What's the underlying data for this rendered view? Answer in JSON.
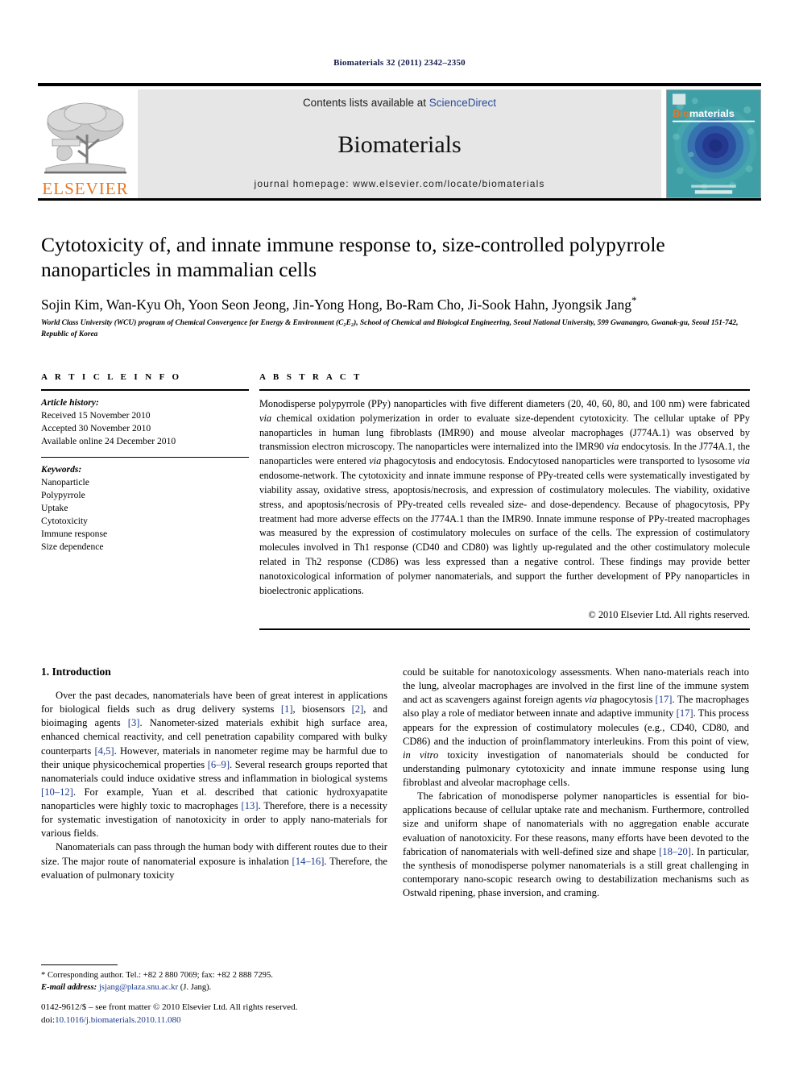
{
  "running_head": "Biomaterials 32 (2011) 2342–2350",
  "masthead": {
    "publisher_name": "ELSEVIER",
    "contents_prefix": "Contents lists available at ",
    "contents_link": "ScienceDirect",
    "journal_name": "Biomaterials",
    "homepage": "journal homepage: www.elsevier.com/locate/biomaterials",
    "cover_title_accent": "Bio",
    "cover_title_rest": "materials",
    "accent_color": "#E87722",
    "link_color": "#2a4b9b",
    "band_color": "#e6e6e6",
    "cover_color": "#2f8f96"
  },
  "article": {
    "title": "Cytotoxicity of, and innate immune response to, size-controlled polypyrrole nanoparticles in mammalian cells",
    "authors": "Sojin Kim, Wan-Kyu Oh, Yoon Seon Jeong, Jin-Yong Hong, Bo-Ram Cho, Ji-Sook Hahn, Jyongsik Jang",
    "corresponding_marker": "*",
    "affiliation": "World Class University (WCU) program of Chemical Convergence for Energy & Environment (C₂E₂), School of Chemical and Biological Engineering, Seoul National University, 599 Gwanangro, Gwanak-gu, Seoul 151-742, Republic of Korea"
  },
  "article_info": {
    "heading": "A R T I C L E   I N F O",
    "history_label": "Article history:",
    "history": [
      "Received 15 November 2010",
      "Accepted 30 November 2010",
      "Available online 24 December 2010"
    ],
    "keywords_label": "Keywords:",
    "keywords": [
      "Nanoparticle",
      "Polypyrrole",
      "Uptake",
      "Cytotoxicity",
      "Immune response",
      "Size dependence"
    ]
  },
  "abstract": {
    "heading": "A B S T R A C T",
    "paragraphs": [
      "Monodisperse polypyrrole (PPy) nanoparticles with five different diameters (20, 40, 60, 80, and 100 nm) were fabricated <i>via</i> chemical oxidation polymerization in order to evaluate size-dependent cytotoxicity. The cellular uptake of PPy nanoparticles in human lung fibroblasts (IMR90) and mouse alveolar macrophages (J774A.1) was observed by transmission electron microscopy. The nanoparticles were internalized into the IMR90 <i>via</i> endocytosis. In the J774A.1, the nanoparticles were entered <i>via</i> phagocytosis and endocytosis. Endocytosed nanoparticles were transported to lysosome <i>via</i> endosome-network. The cytotoxicity and innate immune response of PPy-treated cells were systematically investigated by viability assay, oxidative stress, apoptosis/necrosis, and expression of costimulatory molecules. The viability, oxidative stress, and apoptosis/necrosis of PPy-treated cells revealed size- and dose-dependency. Because of phagocytosis, PPy treatment had more adverse effects on the J774A.1 than the IMR90. Innate immune response of PPy-treated macrophages was measured by the expression of costimulatory molecules on surface of the cells. The expression of costimulatory molecules involved in Th1 response (CD40 and CD80) was lightly up-regulated and the other costimulatory molecule related in Th2 response (CD86) was less expressed than a negative control. These findings may provide better nanotoxicological information of polymer nanomaterials, and support the further development of PPy nanoparticles in bioelectronic applications."
    ],
    "copyright": "© 2010 Elsevier Ltd. All rights reserved."
  },
  "section": {
    "number_title": "1.  Introduction",
    "left_paragraphs": [
      "Over the past decades, nanomaterials have been of great interest in applications for biological fields such as drug delivery systems <span class=\"ref\">[1]</span>, biosensors <span class=\"ref\">[2]</span>, and bioimaging agents <span class=\"ref\">[3]</span>. Nanometer-sized materials exhibit high surface area, enhanced chemical reactivity, and cell penetration capability compared with bulky counterparts <span class=\"ref\">[4,5]</span>. However, materials in nanometer regime may be harmful due to their unique physicochemical properties <span class=\"ref\">[6–9]</span>. Several research groups reported that nanomaterials could induce oxidative stress and inflammation in biological systems <span class=\"ref\">[10–12]</span>. For example, Yuan et al. described that cationic hydroxyapatite nanoparticles were highly toxic to macrophages <span class=\"ref\">[13]</span>. Therefore, there is a necessity for systematic investigation of nanotoxicity in order to apply nano-materials for various fields.",
      "Nanomaterials can pass through the human body with different routes due to their size. The major route of nanomaterial exposure is inhalation <span class=\"ref\">[14–16]</span>. Therefore, the evaluation of pulmonary toxicity"
    ],
    "right_paragraphs": [
      "could be suitable for nanotoxicology assessments. When nano-materials reach into the lung, alveolar macrophages are involved in the first line of the immune system and act as scavengers against foreign agents <i>via</i> phagocytosis <span class=\"ref\">[17]</span>. The macrophages also play a role of mediator between innate and adaptive immunity <span class=\"ref\">[17]</span>. This process appears for the expression of costimulatory molecules (e.g., CD40, CD80, and CD86) and the induction of proinflammatory interleukins. From this point of view, <i>in vitro</i> toxicity investigation of nanomaterials should be conducted for understanding pulmonary cytotoxicity and innate immune response using lung fibroblast and alveolar macrophage cells.",
      "The fabrication of monodisperse polymer nanoparticles is essential for bio-applications because of cellular uptake rate and mechanism. Furthermore, controlled size and uniform shape of nanomaterials with no aggregation enable accurate evaluation of nanotoxicity. For these reasons, many efforts have been devoted to the fabrication of nanomaterials with well-defined size and shape <span class=\"ref\">[18–20]</span>. In particular, the synthesis of monodisperse polymer nanomaterials is a still great challenging in contemporary nano-scopic research owing to destabilization mechanisms such as Ostwald ripening, phase inversion, and craming."
    ]
  },
  "footnote": {
    "corresponding": "* Corresponding author. Tel.: +82 2 880 7069; fax: +82 2 888 7295.",
    "email_label": "E-mail address:",
    "email": "jsjang@plaza.snu.ac.kr",
    "email_suffix": "(J. Jang)."
  },
  "colophon": {
    "line1": "0142-9612/$ – see front matter © 2010 Elsevier Ltd. All rights reserved.",
    "doi_prefix": "doi:",
    "doi": "10.1016/j.biomaterials.2010.11.080"
  }
}
